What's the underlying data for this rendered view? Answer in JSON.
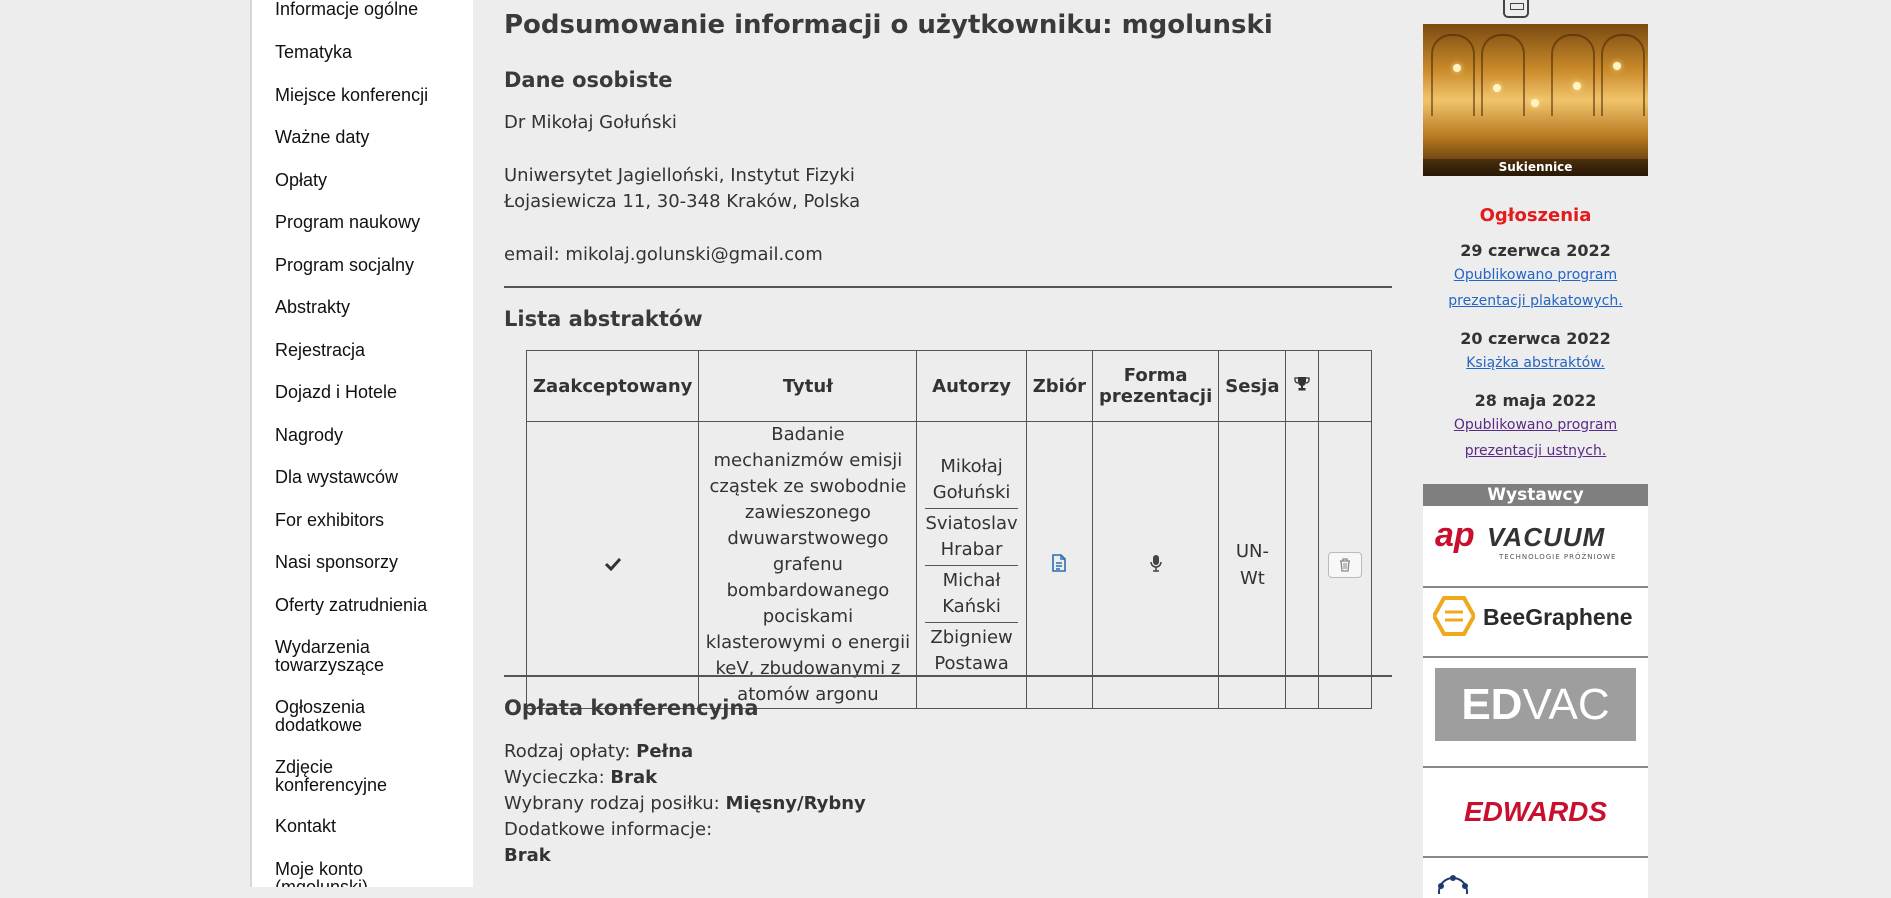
{
  "nav": {
    "items": [
      "Informacje ogólne",
      "Tematyka",
      "Miejsce konferencji",
      "Ważne daty",
      "Opłaty",
      "Program naukowy",
      "Program socjalny",
      "Abstrakty",
      "Rejestracja",
      "Dojazd i Hotele",
      "Nagrody",
      "Dla wystawców",
      "For exhibitors",
      "Nasi sponsorzy",
      "Oferty zatrudnienia",
      "Wydarzenia towarzyszące",
      "Ogłoszenia dodatkowe",
      "Zdjęcie konferencyjne",
      "Kontakt",
      "Moje konto (mgolunski)"
    ]
  },
  "main": {
    "title": "Podsumowanie informacji o użytkowniku: mgolunski",
    "personal": {
      "heading": "Dane osobiste",
      "name": "Dr Mikołaj Gołuński",
      "affiliation": "Uniwersytet Jagielloński, Instytut Fizyki",
      "address": "Łojasiewicza 11, 30-348 Kraków, Polska",
      "email": "email: mikolaj.golunski@gmail.com"
    },
    "abstracts": {
      "heading": "Lista abstraktów",
      "columns": [
        "Zaakceptowany",
        "Tytuł",
        "Autorzy",
        "Zbiór",
        "Forma prezentacji",
        "Sesja"
      ],
      "row": {
        "accepted_icon": "check-icon",
        "title": "Badanie mechanizmów emisji cząstek ze swobodnie zawieszonego dwuwarstwowego grafenu bombardowanego pociskami klasterowymi o energii keV, zbudowanymi z atomów argonu",
        "authors": [
          "Mikołaj Gołuński",
          "Sviatoslav Hrabar",
          "Michał Kański",
          "Zbigniew Postawa"
        ],
        "session": "UN-Wt"
      }
    },
    "fee": {
      "heading": "Opłata konferencyjna",
      "fee_label": "Rodzaj opłaty:",
      "fee_value": "Pełna",
      "trip_label": "Wycieczka:",
      "trip_value": "Brak",
      "meal_label": "Wybrany rodzaj posiłku:",
      "meal_value": "Mięsny/Rybny",
      "extra_label": "Dodatkowe informacje:",
      "extra_value": "Brak"
    }
  },
  "right": {
    "photo_caption": "Sukiennice",
    "announcements_title": "Ogłoszenia",
    "announcements": [
      {
        "date": "29 czerwca 2022",
        "link": "Opublikowano program prezentacji plakatowych."
      },
      {
        "date": "20 czerwca 2022",
        "link": "Książka abstraktów."
      },
      {
        "date": "28 maja 2022",
        "link": "Opublikowano program prezentacji ustnych."
      }
    ],
    "exhibitors_title": "Wystawcy",
    "sponsors": {
      "s1_a": "ap",
      "s1_b": "VACUUM",
      "s1_sub": "TECHNOLOGIE PRÓŻNIOWE",
      "s2": "BeeGraphene",
      "s3_a": "ED",
      "s3_b": "VAC",
      "s4": "EDWARDS"
    }
  },
  "colors": {
    "background": "#ededed",
    "announcement_title": "#e31b1b",
    "link": "#2464c5",
    "visited_link": "#5b2a86",
    "exhibitors_bar": "#7f7f7f",
    "sponsor_red": "#c8102e",
    "beegraphene_orange": "#f0a81e",
    "edvac_gray": "#9e9e9e"
  }
}
